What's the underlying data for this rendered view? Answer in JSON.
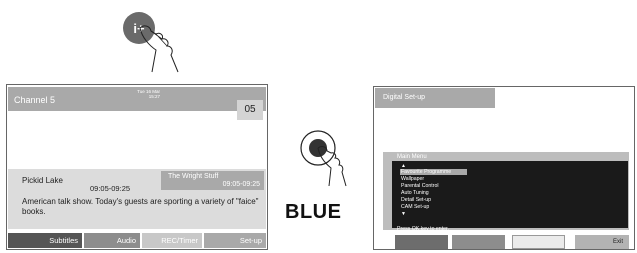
{
  "remote_button": {
    "symbol": "i+"
  },
  "left_screen": {
    "channel": "Channel 5",
    "date": "Tue 16 Mar",
    "time": "15:27",
    "channel_number": "05",
    "now": {
      "title": "Pickid Lake",
      "time": "09:05-09:25"
    },
    "next": {
      "title": "The Wright Stuff",
      "time": "09:05-09:25"
    },
    "synopsis": "American talk show. Today's guests are sporting a variety of \"faice\" books.",
    "buttons": {
      "subtitles": "Subtitles",
      "audio": "Audio",
      "rec_timer": "REC/Timer",
      "setup": "Set-up"
    }
  },
  "middle": {
    "label": "BLUE"
  },
  "right_screen": {
    "title": "Digital Set-up",
    "menu_title": "Main Menu",
    "up_arrow": "▲",
    "down_arrow": "▼",
    "items": [
      "Favourite Programme",
      "Wallpaper",
      "Parental Control",
      "Auto Tuning",
      "Detail Set-up",
      "CAM Set-up"
    ],
    "hint": "Press OK key  to enter.",
    "buttons": {
      "exit": "Exit"
    }
  },
  "colors": {
    "header_gray": "#a9a9a9",
    "panel_dark": "#1a1a1a",
    "button_dark": "#555555"
  }
}
